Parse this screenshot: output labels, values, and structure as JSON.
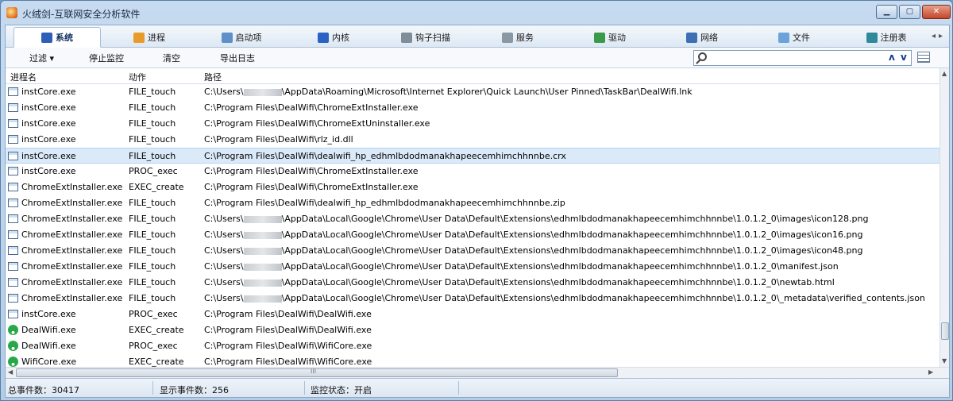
{
  "window": {
    "title": "火绒剑-互联网安全分析软件"
  },
  "tabs": [
    {
      "label": "系统",
      "icon": "system-icon",
      "color": "#2d5fb8",
      "active": true
    },
    {
      "label": "进程",
      "icon": "process-icon",
      "color": "#e89b2a"
    },
    {
      "label": "启动项",
      "icon": "startup-icon",
      "color": "#5f8fc8"
    },
    {
      "label": "内核",
      "icon": "kernel-icon",
      "color": "#2a62c4"
    },
    {
      "label": "钩子扫描",
      "icon": "hook-scan-icon",
      "color": "#7f8c99"
    },
    {
      "label": "服务",
      "icon": "service-icon",
      "color": "#8a97a5"
    },
    {
      "label": "驱动",
      "icon": "driver-icon",
      "color": "#3a9a4a"
    },
    {
      "label": "网络",
      "icon": "network-icon",
      "color": "#3c6fb4"
    },
    {
      "label": "文件",
      "icon": "file-icon",
      "color": "#6ba3d8"
    },
    {
      "label": "注册表",
      "icon": "registry-icon",
      "color": "#2e8a9a"
    }
  ],
  "toolbar": {
    "filter_label": "过滤 ▾",
    "stop_label": "停止监控",
    "clear_label": "清空",
    "export_label": "导出日志",
    "search_placeholder": "",
    "nav_up": "ʌ",
    "nav_down": "v"
  },
  "columns": {
    "name": "进程名",
    "action": "动作",
    "path": "路径"
  },
  "rows": [
    {
      "name": "instCore.exe",
      "action": "FILE_touch",
      "pre": "C:\\Users\\",
      "blur": true,
      "post": "\\AppData\\Roaming\\Microsoft\\Internet Explorer\\Quick Launch\\User Pinned\\TaskBar\\DealWifi.lnk",
      "icon": "exe"
    },
    {
      "name": "instCore.exe",
      "action": "FILE_touch",
      "pre": "C:\\Program Files\\DealWifi\\ChromeExtInstaller.exe",
      "icon": "exe"
    },
    {
      "name": "instCore.exe",
      "action": "FILE_touch",
      "pre": "C:\\Program Files\\DealWifi\\ChromeExtUninstaller.exe",
      "icon": "exe"
    },
    {
      "name": "instCore.exe",
      "action": "FILE_touch",
      "pre": "C:\\Program Files\\DealWifi\\rlz_id.dll",
      "icon": "exe"
    },
    {
      "name": "instCore.exe",
      "action": "FILE_touch",
      "pre": "C:\\Program Files\\DealWifi\\dealwifi_hp_edhmlbdodmanakhapeecemhimchhnnbe.crx",
      "icon": "exe",
      "selected": true
    },
    {
      "name": "instCore.exe",
      "action": "PROC_exec",
      "pre": "C:\\Program Files\\DealWifi\\ChromeExtInstaller.exe",
      "icon": "exe"
    },
    {
      "name": "ChromeExtInstaller.exe",
      "action": "EXEC_create",
      "pre": "C:\\Program Files\\DealWifi\\ChromeExtInstaller.exe",
      "icon": "exe"
    },
    {
      "name": "ChromeExtInstaller.exe",
      "action": "FILE_touch",
      "pre": "C:\\Program Files\\DealWifi\\dealwifi_hp_edhmlbdodmanakhapeecemhimchhnnbe.zip",
      "icon": "exe"
    },
    {
      "name": "ChromeExtInstaller.exe",
      "action": "FILE_touch",
      "pre": "C:\\Users\\",
      "blur": true,
      "post": "\\AppData\\Local\\Google\\Chrome\\User Data\\Default\\Extensions\\edhmlbdodmanakhapeecemhimchhnnbe\\1.0.1.2_0\\images\\icon128.png",
      "icon": "exe"
    },
    {
      "name": "ChromeExtInstaller.exe",
      "action": "FILE_touch",
      "pre": "C:\\Users\\",
      "blur": true,
      "post": "\\AppData\\Local\\Google\\Chrome\\User Data\\Default\\Extensions\\edhmlbdodmanakhapeecemhimchhnnbe\\1.0.1.2_0\\images\\icon16.png",
      "icon": "exe"
    },
    {
      "name": "ChromeExtInstaller.exe",
      "action": "FILE_touch",
      "pre": "C:\\Users\\",
      "blur": true,
      "post": "\\AppData\\Local\\Google\\Chrome\\User Data\\Default\\Extensions\\edhmlbdodmanakhapeecemhimchhnnbe\\1.0.1.2_0\\images\\icon48.png",
      "icon": "exe"
    },
    {
      "name": "ChromeExtInstaller.exe",
      "action": "FILE_touch",
      "pre": "C:\\Users\\",
      "blur": true,
      "post": "\\AppData\\Local\\Google\\Chrome\\User Data\\Default\\Extensions\\edhmlbdodmanakhapeecemhimchhnnbe\\1.0.1.2_0\\manifest.json",
      "icon": "exe"
    },
    {
      "name": "ChromeExtInstaller.exe",
      "action": "FILE_touch",
      "pre": "C:\\Users\\",
      "blur": true,
      "post": "\\AppData\\Local\\Google\\Chrome\\User Data\\Default\\Extensions\\edhmlbdodmanakhapeecemhimchhnnbe\\1.0.1.2_0\\newtab.html",
      "icon": "exe"
    },
    {
      "name": "ChromeExtInstaller.exe",
      "action": "FILE_touch",
      "pre": "C:\\Users\\",
      "blur": true,
      "post": "\\AppData\\Local\\Google\\Chrome\\User Data\\Default\\Extensions\\edhmlbdodmanakhapeecemhimchhnnbe\\1.0.1.2_0\\_metadata\\verified_contents.json",
      "icon": "exe"
    },
    {
      "name": "instCore.exe",
      "action": "PROC_exec",
      "pre": "C:\\Program Files\\DealWifi\\DealWifi.exe",
      "icon": "exe"
    },
    {
      "name": "DealWifi.exe",
      "action": "EXEC_create",
      "pre": "C:\\Program Files\\DealWifi\\DealWifi.exe",
      "icon": "wifi"
    },
    {
      "name": "DealWifi.exe",
      "action": "PROC_exec",
      "pre": "C:\\Program Files\\DealWifi\\WifiCore.exe",
      "icon": "wifi"
    },
    {
      "name": "WifiCore.exe",
      "action": "EXEC_create",
      "pre": "C:\\Program Files\\DealWifi\\WifiCore.exe",
      "icon": "wifi"
    }
  ],
  "status": {
    "total": "总事件数：30417",
    "shown": "显示事件数：256",
    "monitor": "监控状态：开启"
  }
}
